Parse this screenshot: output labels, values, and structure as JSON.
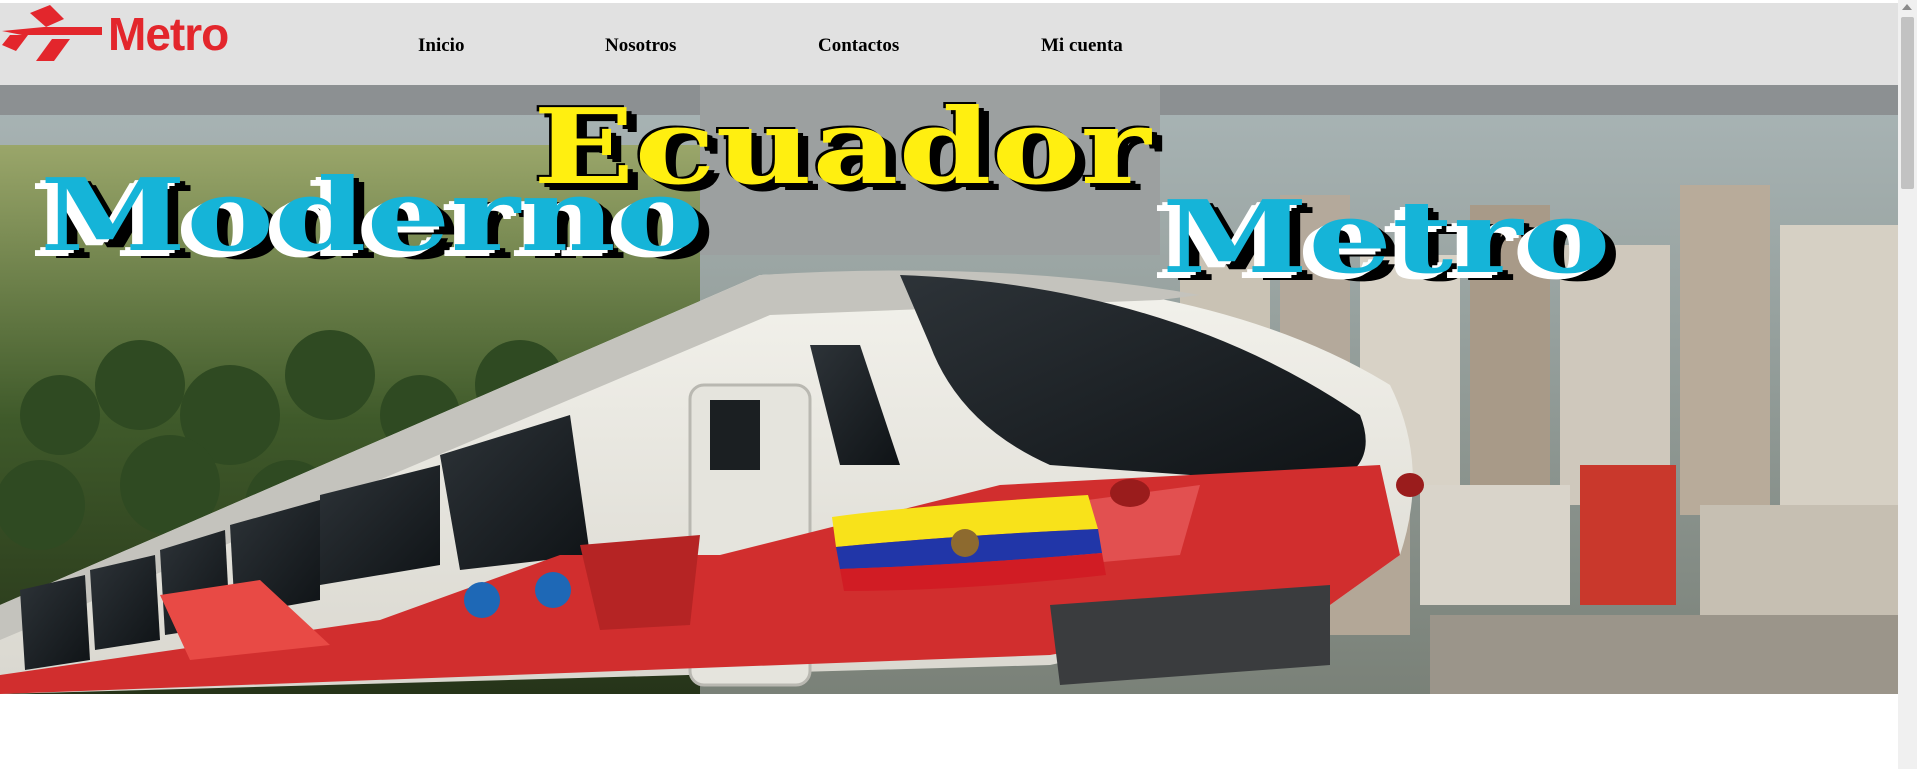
{
  "brand": {
    "name": "Metro",
    "color": "#e3262c",
    "icon": "metro-logo-icon"
  },
  "nav": {
    "background": "#e1e1e1",
    "items": [
      {
        "label": "Inicio"
      },
      {
        "label": "Nosotros"
      },
      {
        "label": "Contactos"
      },
      {
        "label": "Mi cuenta"
      }
    ]
  },
  "hero": {
    "line1": "Ecuador",
    "line2a": "Moderno",
    "line2b": "Metro",
    "colors": {
      "yellow": "#ffef10",
      "cyan": "#15b4d8"
    },
    "image": "metro-train-city-banner"
  }
}
